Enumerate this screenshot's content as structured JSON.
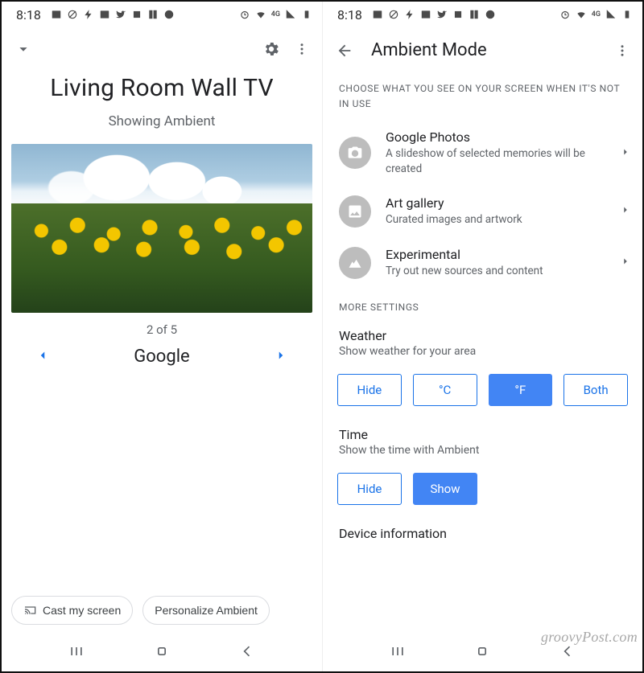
{
  "status": {
    "time": "8:18",
    "icons_left": [
      "image-icon",
      "sync-off-icon",
      "bolt-icon",
      "picture-icon",
      "twitter-icon",
      "dropbox-icon",
      "book-icon",
      "disc-icon"
    ],
    "icons_right": [
      "alarm-icon",
      "wifi-icon",
      "4g-icon",
      "signal-icon",
      "battery-icon"
    ]
  },
  "screen1": {
    "device_title": "Living Room Wall TV",
    "subtitle": "Showing Ambient",
    "pager": {
      "current": 2,
      "total": 5,
      "text": "2 of 5",
      "label": "Google"
    },
    "actions": {
      "cast": "Cast my screen",
      "personalize": "Personalize Ambient"
    }
  },
  "screen2": {
    "title": "Ambient Mode",
    "caption": "CHOOSE WHAT YOU SEE ON YOUR SCREEN WHEN IT'S NOT IN USE",
    "options": [
      {
        "icon": "camera-icon",
        "title": "Google Photos",
        "subtitle": "A slideshow of selected memories will be created"
      },
      {
        "icon": "image-icon",
        "title": "Art gallery",
        "subtitle": "Curated images and artwork"
      },
      {
        "icon": "mountain-icon",
        "title": "Experimental",
        "subtitle": "Try out new sources and content"
      }
    ],
    "more_settings_caption": "MORE SETTINGS",
    "weather": {
      "title": "Weather",
      "subtitle": "Show weather for your area",
      "choices": [
        "Hide",
        "°C",
        "°F",
        "Both"
      ],
      "selected": "°F"
    },
    "time": {
      "title": "Time",
      "subtitle": "Show the time with Ambient",
      "choices": [
        "Hide",
        "Show"
      ],
      "selected": "Show"
    },
    "device_info_title": "Device information"
  },
  "watermark": "groovyPost.com"
}
